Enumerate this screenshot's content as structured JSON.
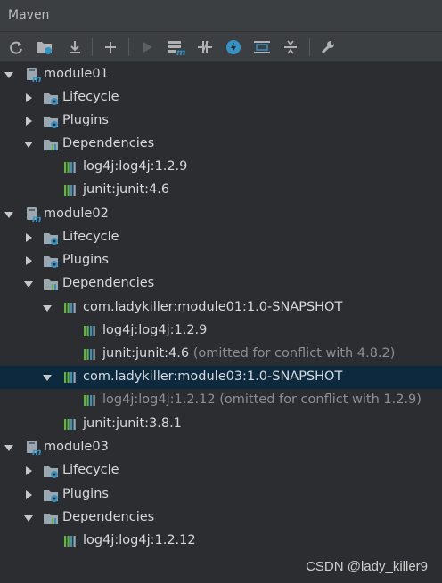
{
  "panel": {
    "title": "Maven"
  },
  "toolbar": {
    "buttons": [
      {
        "name": "reload-icon"
      },
      {
        "name": "generate-sources-icon"
      },
      {
        "name": "download-icon"
      },
      {
        "name": "add-icon"
      },
      {
        "name": "run-icon"
      },
      {
        "name": "execute-goal-icon"
      },
      {
        "name": "toggle-offline-icon"
      },
      {
        "name": "skip-tests-icon"
      },
      {
        "name": "show-dependencies-icon"
      },
      {
        "name": "collapse-all-icon"
      },
      {
        "name": "settings-wrench-icon"
      }
    ]
  },
  "tree": {
    "module01": {
      "name": "module01",
      "lifecycle": "Lifecycle",
      "plugins": "Plugins",
      "dependencies": "Dependencies",
      "deps": [
        "log4j:log4j:1.2.9",
        "junit:junit:4.6"
      ]
    },
    "module02": {
      "name": "module02",
      "lifecycle": "Lifecycle",
      "plugins": "Plugins",
      "dependencies": "Dependencies",
      "dep_module01": "com.ladykiller:module01:1.0-SNAPSHOT",
      "dep_module01_children": {
        "log4j": "log4j:log4j:1.2.9",
        "junit": "junit:junit:4.6",
        "junit_note": "(omitted for conflict with 4.8.2)"
      },
      "dep_module03": "com.ladykiller:module03:1.0-SNAPSHOT",
      "dep_module03_children": {
        "log4j": "log4j:log4j:1.2.12",
        "log4j_note": "(omitted for conflict with 1.2.9)"
      },
      "junit": "junit:junit:3.8.1"
    },
    "module03": {
      "name": "module03",
      "lifecycle": "Lifecycle",
      "plugins": "Plugins",
      "dependencies": "Dependencies",
      "deps": [
        "log4j:log4j:1.2.12"
      ]
    }
  },
  "watermark": "CSDN @lady_killer9",
  "colors": {
    "selected_row": "#0d293e",
    "library_icon": "#62b543",
    "maven_m": "#3592c4"
  }
}
